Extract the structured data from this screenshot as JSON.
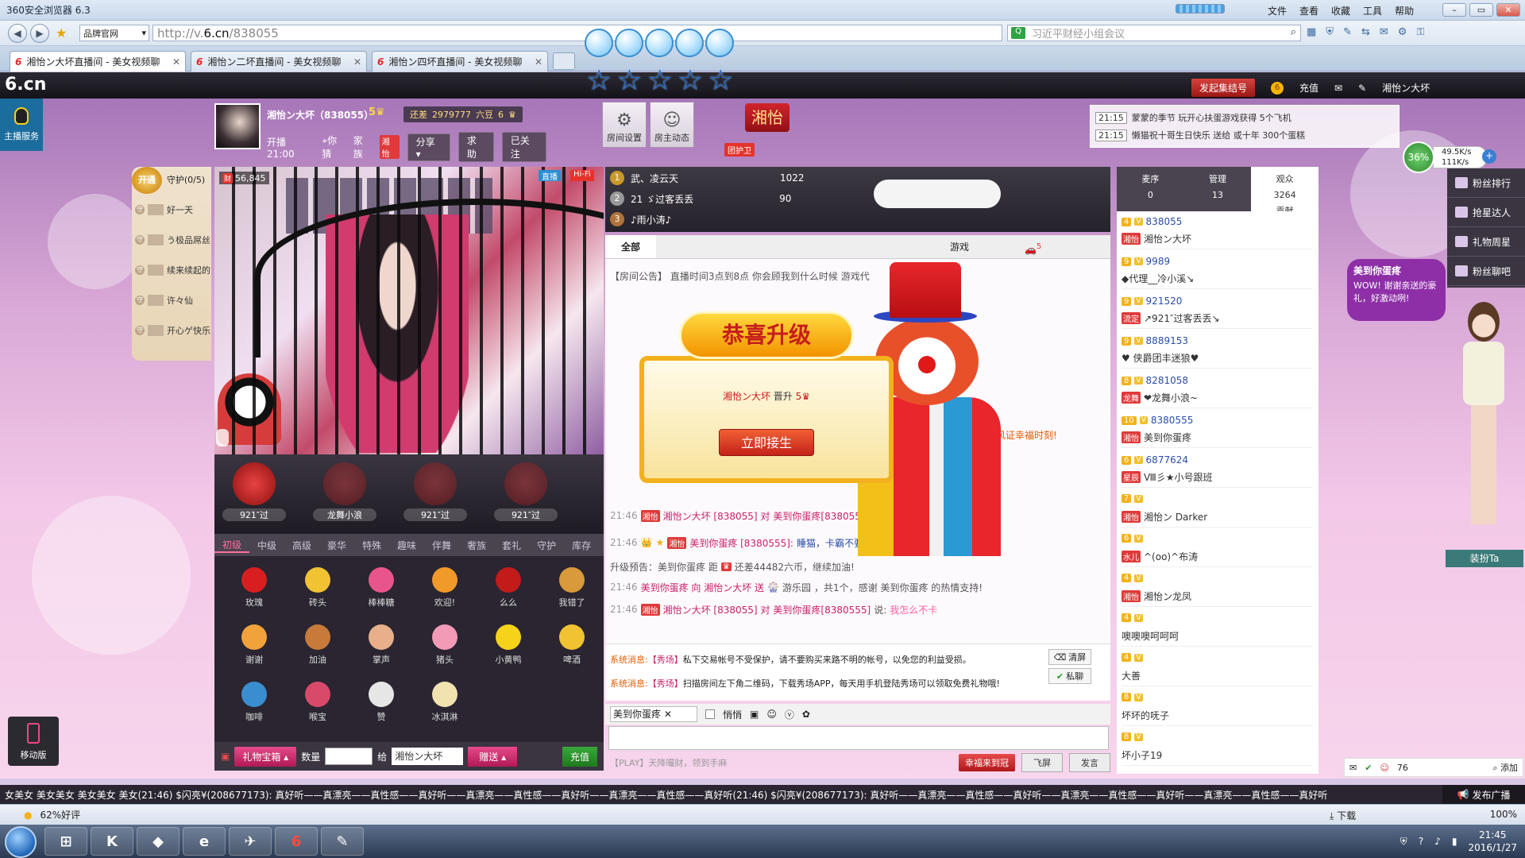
{
  "browser": {
    "app_title": "360安全浏览器 6.3",
    "menu": [
      "文件",
      "查看",
      "收藏",
      "工具",
      "帮助"
    ],
    "brand_select": "品牌官网",
    "url_prefix": "http://v.",
    "url_domain": "6.cn",
    "url_path": "/838055",
    "search_placeholder": "习近平财经小组会议",
    "tabs": [
      {
        "label": "湘怡ン大坏直播间 - 美女视频聊"
      },
      {
        "label": "湘怡ン二坏直播间 - 美女视频聊"
      },
      {
        "label": "湘怡ン四坏直播间 - 美女视频聊"
      }
    ]
  },
  "site": {
    "logo": "6.cn",
    "anchor_service": "主播服务",
    "header_gather": "发起集结号",
    "header_recharge": "充值",
    "header_user": "湘怡ン大坏"
  },
  "host": {
    "name": "湘怡ン大坏（838055）",
    "level": "5",
    "diff_label": "还差",
    "diff_value": "2979777",
    "diff_unit": "六豆",
    "next_level": "6",
    "start_time": "开播 21:00",
    "location": "你猜",
    "family_label": "家族",
    "family_badge": "湘怡",
    "share": "分享",
    "help": "求助",
    "follow": "已关注"
  },
  "room": {
    "settings": "房间设置",
    "dynamics": "房主动态",
    "sign": "湘怡",
    "guard_team": "团护卫"
  },
  "headlines": [
    {
      "time": "21:15",
      "text": "蒙蒙的季节 玩开心扶蛋游戏获得 5个飞机"
    },
    {
      "time": "21:15",
      "text": "懒猫祝十哥生日快乐 送给 或十年 300个蛋糕"
    }
  ],
  "speed": {
    "percent": "36%",
    "up": "49.5K/s",
    "down": "111K/s",
    "plus": "+"
  },
  "guard": {
    "open": "开通",
    "title": "守护(0/5)",
    "items": [
      "好一天",
      "う极品屌丝",
      "续来续起的",
      "许々仙",
      "开心ゲ快乐"
    ],
    "dot": "守"
  },
  "video": {
    "fortune_badge": "财",
    "fortune": "56,845",
    "tag_live": "直播",
    "tag_hifi": "Hi-Fi"
  },
  "hot_gifts": [
    "921″过",
    "龙舞小浪",
    "921″过",
    "921″过"
  ],
  "gift_tabs": [
    "初级",
    "中级",
    "高级",
    "豪华",
    "特殊",
    "趣味",
    "伴舞",
    "奢族",
    "套礼",
    "守护",
    "库存"
  ],
  "gifts": [
    {
      "name": "玫瑰",
      "color": "#d81e1e"
    },
    {
      "name": "砖头",
      "color": "#f1c232"
    },
    {
      "name": "棒棒糖",
      "color": "#e8548c"
    },
    {
      "name": "欢迎!",
      "color": "#f19a2a"
    },
    {
      "name": "么么",
      "color": "#c31a1a"
    },
    {
      "name": "我错了",
      "color": "#d89a3a"
    },
    {
      "name": "谢谢",
      "color": "#f1a23a"
    },
    {
      "name": "加油",
      "color": "#c77a3a"
    },
    {
      "name": "掌声",
      "color": "#e7b08a"
    },
    {
      "name": "猪头",
      "color": "#f29ab6"
    },
    {
      "name": "小黄鸭",
      "color": "#f7d21a"
    },
    {
      "name": "啤酒",
      "color": "#f1c232"
    },
    {
      "name": "咖啡",
      "color": "#3a8ed0"
    },
    {
      "name": "喉宝",
      "color": "#d94a6a"
    },
    {
      "name": "赞",
      "color": "#e6e6e6"
    },
    {
      "name": "冰淇淋",
      "color": "#f2e2b0"
    }
  ],
  "gift_bar": {
    "box": "礼物宝箱",
    "qty_label": "数量",
    "to_label": "给",
    "to_name": "湘怡ン大坏",
    "send": "赠送",
    "recharge": "充值"
  },
  "mobile": "移动版",
  "rank": [
    {
      "num": "1",
      "name": "武、凌云天",
      "val": "1022"
    },
    {
      "num": "2",
      "name": "21 ゞ过客丢丢",
      "val": "90"
    },
    {
      "num": "3",
      "name": "♪雨小涛♪",
      "val": ""
    }
  ],
  "chat_tabs": [
    "全部",
    "游戏"
  ],
  "chat_tab_badge": "5",
  "chat_notice": "【房间公告】 直播时间3点到8点 你会顾我到什么时候 游戏代",
  "chat": [
    {
      "time": "21:46",
      "pre": "湘怡ン大坏 [838055] 对",
      "target": "美到你蛋疼[8380555]",
      "tail": "说:",
      "text": ""
    },
    {
      "time": "21:46",
      "pre": "美到你蛋疼 [8380555]:",
      "target": "",
      "tail": "",
      "text": "睡猫，卡霸不要不要滴"
    },
    {
      "time": "",
      "pre": "升级预告：美到你蛋疼 距",
      "target": "",
      "tail": "",
      "text": "还差44482六币，继续加油!"
    },
    {
      "time": "21:46",
      "pre": "美到你蛋疼 向 湘怡ン大坏 送",
      "target": "游乐园",
      "tail": "，共1个，感谢 美到你蛋疼 的热情支持!",
      "text": ""
    },
    {
      "time": "21:46",
      "pre": "湘怡ン大坏 [838055] 对",
      "target": "美到你蛋疼[8380555]",
      "tail": "说:",
      "text": "我怎么不卡"
    }
  ],
  "chat_side_text": "起风证幸福时刻!",
  "upgrade": {
    "title": "恭喜升级",
    "name": "湘怡ン大坏",
    "mid": "晋升",
    "level": "5",
    "button": "立即接生"
  },
  "system": [
    {
      "label": "系统消息:",
      "src": "【秀场】",
      "text": "私下交易帐号不受保护，请不要购买来路不明的帐号，以免您的利益受损。"
    },
    {
      "label": "系统消息:",
      "src": "【秀场】",
      "text": "扫描房间左下角二维码，下载秀场APP，每天用手机登陆秀场可以领取免费礼物哦!"
    }
  ],
  "sys_buttons": [
    "清屏",
    "私聊"
  ],
  "input": {
    "target": "美到你蛋疼",
    "whisper": "悄悄",
    "play_tip": "【PLAY】天降嘬财，领到手麻",
    "lucky": "幸福来到冠",
    "fly": "飞屏",
    "send": "发言"
  },
  "audience": {
    "tabs": [
      {
        "label": "麦序",
        "count": "0"
      },
      {
        "label": "管理",
        "count": "13"
      },
      {
        "label": "观众",
        "count": "3264"
      }
    ],
    "contrib": "贡献",
    "list": [
      {
        "lv": "4",
        "id": "838055",
        "tag": "湘怡",
        "name": "湘怡ン大坏"
      },
      {
        "lv": "9",
        "id": "9989",
        "tag": "",
        "name": "◆代理__冷小溪↘"
      },
      {
        "lv": "9",
        "id": "921520",
        "tag": "流定",
        "name": "↗921″过客丢丢↘"
      },
      {
        "lv": "9",
        "id": "8889153",
        "tag": "",
        "name": "♥ 侠爵团丰迷狼♥"
      },
      {
        "lv": "8",
        "id": "8281058",
        "tag": "龙舞",
        "name": "❤龙舞小浪~"
      },
      {
        "lv": "10",
        "id": "8380555",
        "tag": "湘怡",
        "name": "美到你蛋疼"
      },
      {
        "lv": "6",
        "id": "6877624",
        "tag": "星辰",
        "name": "Ⅷ彡★小号跟班"
      },
      {
        "lv": "7",
        "id": "",
        "tag": "湘怡",
        "name": "湘怡ン Darker"
      },
      {
        "lv": "6",
        "id": "",
        "tag": "水儿",
        "name": "^(oo)^布涛"
      },
      {
        "lv": "4",
        "id": "",
        "tag": "湘怡",
        "name": "湘怡ン龙凤"
      },
      {
        "lv": "4",
        "id": "",
        "tag": "",
        "name": "噢噢噢呵呵呵"
      },
      {
        "lv": "4",
        "id": "",
        "tag": "",
        "name": "大善"
      },
      {
        "lv": "8",
        "id": "",
        "tag": "",
        "name": "坏坏的呒子"
      },
      {
        "lv": "8",
        "id": "",
        "tag": "",
        "name": "坏小子19"
      }
    ],
    "footer_count": "76",
    "footer_add": "添加"
  },
  "sidemenu": [
    "粉丝排行",
    "抢星达人",
    "礼物周星",
    "粉丝聊吧"
  ],
  "bubble": {
    "title": "美到你蛋疼",
    "text": "WOW! 谢谢亲送的豪礼，好激动咧!"
  },
  "dress_btn": "装扮Ta",
  "marquee": "女美女 美女美女 美女美女 美女(21:46)  $闪亮¥(208677173): 真好听——真漂亮——真性感——真好听——真漂亮——真性感——真好听——真漂亮——真性感——真好听(21:46)  $闪亮¥(208677173): 真好听——真漂亮——真性感——真好听——真漂亮——真性感——真好听——真漂亮——真性感——真好听",
  "publish": "发布广播",
  "status": {
    "rating": "62%好评",
    "download": "下载",
    "zoom": "100%"
  },
  "taskbar": {
    "time": "21:45",
    "date": "2016/1/27"
  }
}
